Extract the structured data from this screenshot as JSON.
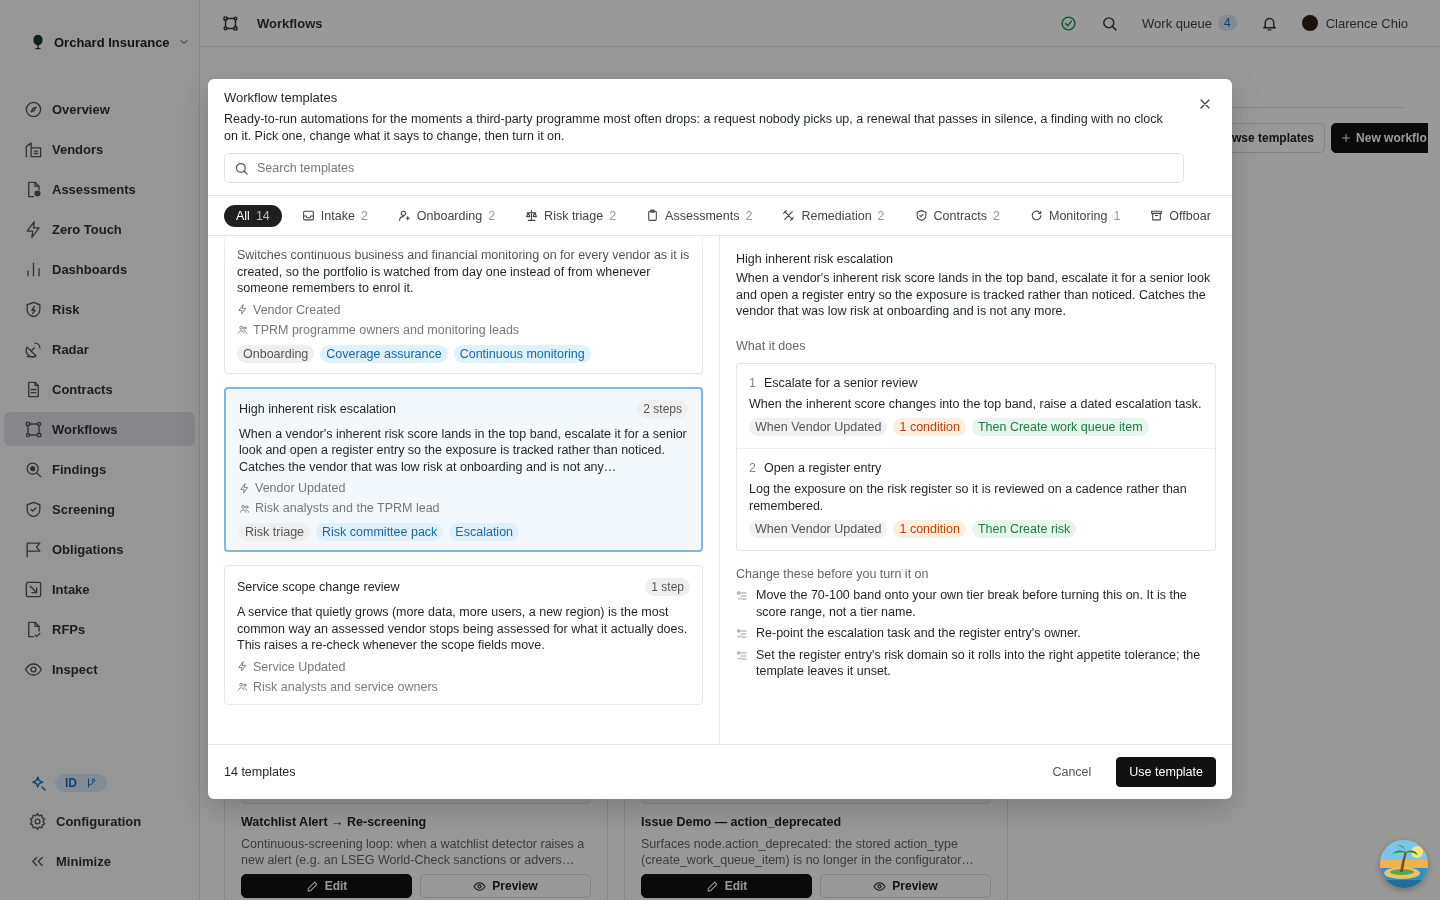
{
  "sidebar": {
    "org": "Orchard Insurance",
    "items": [
      {
        "label": "Overview",
        "selected": false
      },
      {
        "label": "Vendors",
        "selected": false
      },
      {
        "label": "Assessments",
        "selected": false
      },
      {
        "label": "Zero Touch",
        "selected": false
      },
      {
        "label": "Dashboards",
        "selected": false
      },
      {
        "label": "Risk",
        "selected": false
      },
      {
        "label": "Radar",
        "selected": false
      },
      {
        "label": "Contracts",
        "selected": false
      },
      {
        "label": "Workflows",
        "selected": true
      },
      {
        "label": "Findings",
        "selected": false
      },
      {
        "label": "Screening",
        "selected": false
      },
      {
        "label": "Obligations",
        "selected": false
      },
      {
        "label": "Intake",
        "selected": false
      },
      {
        "label": "RFPs",
        "selected": false
      },
      {
        "label": "Inspect",
        "selected": false
      }
    ],
    "badge": "ID",
    "footer_items": [
      "Configuration",
      "Minimize"
    ]
  },
  "topbar": {
    "title": "Workflows",
    "work_queue": {
      "label": "Work queue",
      "count": "4"
    },
    "user": "Clarence Chio"
  },
  "page": {
    "actions": [
      {
        "label": "wse templates",
        "kind": "secondary"
      },
      {
        "label": "New workflo",
        "kind": "primary"
      }
    ],
    "cards": [
      {
        "title": "Watchlist Alert → Re-screening",
        "description": "Continuous-screening loop: when a watchlist detector raises a new alert (e.g. an LSEG World-Check sanctions or advers…",
        "buttons": [
          "Edit",
          "Preview"
        ]
      },
      {
        "title": "Issue Demo — action_deprecated",
        "description": "Surfaces node.action_deprecated: the stored action_type (create_work_queue_item) is no longer in the configurator…",
        "buttons": [
          "Edit",
          "Preview"
        ]
      }
    ]
  },
  "modal": {
    "title": "Workflow templates",
    "description": "Ready-to-run automations for the moments a third-party programme most often drops: a request nobody picks up, a renewal that passes in silence, a finding with no clock on it. Pick one, change what it says to change, then turn it on.",
    "search": {
      "placeholder": "Search templates"
    },
    "tabs": [
      {
        "label": "All",
        "count": "14",
        "selected": true
      },
      {
        "label": "Intake",
        "count": "2",
        "selected": false
      },
      {
        "label": "Onboarding",
        "count": "2",
        "selected": false
      },
      {
        "label": "Risk triage",
        "count": "2",
        "selected": false
      },
      {
        "label": "Assessments",
        "count": "2",
        "selected": false
      },
      {
        "label": "Remediation",
        "count": "2",
        "selected": false
      },
      {
        "label": "Contracts",
        "count": "2",
        "selected": false
      },
      {
        "label": "Monitoring",
        "count": "1",
        "selected": false
      },
      {
        "label": "Offboar",
        "selected": false
      }
    ],
    "templates": [
      {
        "description": "Switches continuous business and financial monitoring on for every vendor as it is created, so the portfolio is watched from day one instead of from whenever someone remembers to enrol it.",
        "trigger": "Vendor Created",
        "audience": "TPRM programme owners and monitoring leads",
        "tags": [
          {
            "label": "Onboarding",
            "kind": "category"
          },
          {
            "label": "Coverage assurance",
            "kind": "topic"
          },
          {
            "label": "Continuous monitoring",
            "kind": "topic"
          }
        ],
        "selected": false
      },
      {
        "title": "High inherent risk escalation",
        "steps": "2 steps",
        "description": "When a vendor's inherent risk score lands in the top band, escalate it for a senior look and open a register entry so the exposure is tracked rather than noticed. Catches the vendor that was low risk at onboarding and is not any…",
        "trigger": "Vendor Updated",
        "audience": "Risk analysts and the TPRM lead",
        "tags": [
          {
            "label": "Risk triage",
            "kind": "category"
          },
          {
            "label": "Risk committee pack",
            "kind": "topic"
          },
          {
            "label": "Escalation",
            "kind": "topic"
          }
        ],
        "selected": true
      },
      {
        "title": "Service scope change review",
        "steps": "1 step",
        "description": "A service that quietly grows (more data, more users, a new region) is the most common way an assessed vendor stops being assessed for what it actually does. This raises a re-check whenever the scope fields move.",
        "trigger": "Service Updated",
        "audience": "Risk analysts and service owners",
        "selected": false
      }
    ],
    "detail": {
      "title": "High inherent risk escalation",
      "description": "When a vendor's inherent risk score lands in the top band, escalate it for a senior look and open a register entry so the exposure is tracked rather than noticed. Catches the vendor that was low risk at onboarding and is not any more.",
      "steps_heading": "What it does",
      "steps": [
        {
          "number": "1",
          "title": "Escalate for a senior review",
          "description": "When the inherent score changes into the top band, raise a dated escalation task.",
          "chips": [
            {
              "label": "When Vendor Updated",
              "kind": "trigger"
            },
            {
              "label": "1 condition",
              "kind": "condition"
            },
            {
              "label": "Then Create work queue item",
              "kind": "action"
            }
          ]
        },
        {
          "number": "2",
          "title": "Open a register entry",
          "description": "Log the exposure on the risk register so it is reviewed on a cadence rather than remembered.",
          "chips": [
            {
              "label": "When Vendor Updated",
              "kind": "trigger"
            },
            {
              "label": "1 condition",
              "kind": "condition"
            },
            {
              "label": "Then Create risk",
              "kind": "action"
            }
          ]
        }
      ],
      "checklist_heading": "Change these before you turn it on",
      "checklist": [
        "Move the 70-100 band onto your own tier break before turning this on. It is the score range, not a tier name.",
        "Re-point the escalation task and the register entry's owner.",
        "Set the register entry's risk domain so it rolls into the right appetite tolerance; the template leaves it unset."
      ]
    },
    "footer": {
      "count": "14 templates",
      "buttons": [
        {
          "label": "Cancel",
          "kind": "ghost"
        },
        {
          "label": "Use template",
          "kind": "primary"
        }
      ]
    }
  }
}
